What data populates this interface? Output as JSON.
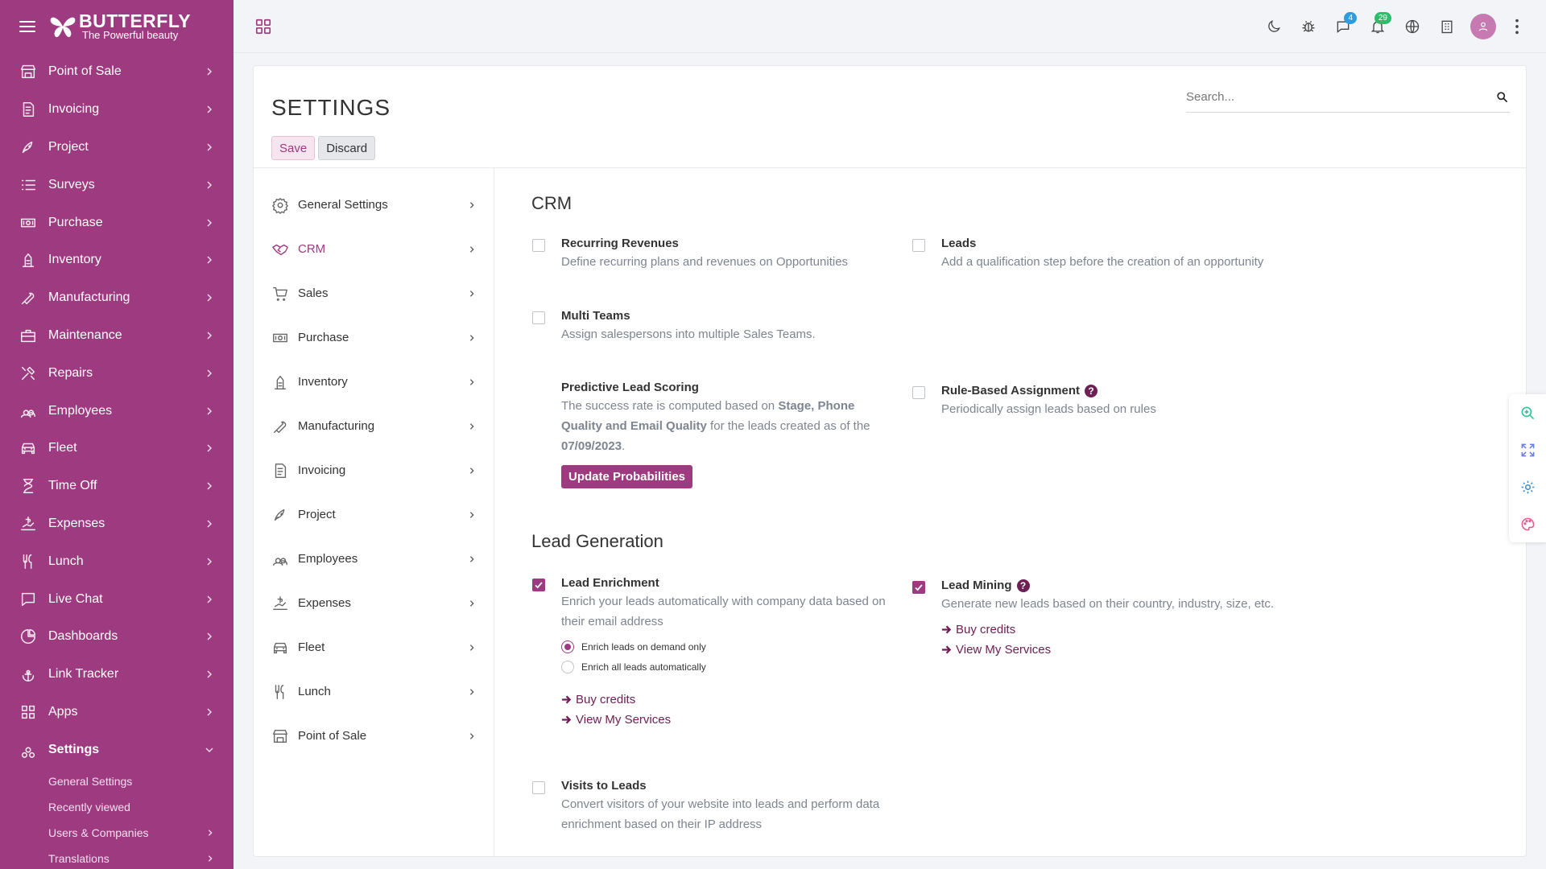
{
  "brand": {
    "name": "BUTTERFLY",
    "tagline": "The Powerful beauty"
  },
  "sidebar": {
    "items": [
      {
        "label": "Point of Sale",
        "icon": "store-icon"
      },
      {
        "label": "Invoicing",
        "icon": "invoice-icon"
      },
      {
        "label": "Project",
        "icon": "rocket-icon"
      },
      {
        "label": "Surveys",
        "icon": "list-icon"
      },
      {
        "label": "Purchase",
        "icon": "cash-icon"
      },
      {
        "label": "Inventory",
        "icon": "inventory-icon"
      },
      {
        "label": "Manufacturing",
        "icon": "wrench-icon"
      },
      {
        "label": "Maintenance",
        "icon": "briefcase-icon"
      },
      {
        "label": "Repairs",
        "icon": "tools-icon"
      },
      {
        "label": "Employees",
        "icon": "users-icon"
      },
      {
        "label": "Fleet",
        "icon": "car-icon"
      },
      {
        "label": "Time Off",
        "icon": "hourglass-icon"
      },
      {
        "label": "Expenses",
        "icon": "expense-icon"
      },
      {
        "label": "Lunch",
        "icon": "utensils-icon"
      },
      {
        "label": "Live Chat",
        "icon": "chat-icon"
      },
      {
        "label": "Dashboards",
        "icon": "pie-icon"
      },
      {
        "label": "Link Tracker",
        "icon": "anchor-icon"
      },
      {
        "label": "Apps",
        "icon": "apps-icon"
      },
      {
        "label": "Settings",
        "icon": "settings-icon"
      }
    ],
    "subitems": [
      "General Settings",
      "Recently viewed",
      "Users & Companies",
      "Translations"
    ]
  },
  "topbar": {
    "chat_badge": "4",
    "notif_badge": "29"
  },
  "page": {
    "title": "SETTINGS",
    "save_label": "Save",
    "discard_label": "Discard",
    "search_placeholder": "Search..."
  },
  "menu": [
    "General Settings",
    "CRM",
    "Sales",
    "Purchase",
    "Inventory",
    "Manufacturing",
    "Invoicing",
    "Project",
    "Employees",
    "Expenses",
    "Fleet",
    "Lunch",
    "Point of Sale"
  ],
  "crm": {
    "title": "CRM",
    "recurring": {
      "title": "Recurring Revenues",
      "desc": "Define recurring plans and revenues on Opportunities",
      "checked": false
    },
    "leads": {
      "title": "Leads",
      "desc": "Add a qualification step before the creation of an opportunity",
      "checked": false
    },
    "multi_teams": {
      "title": "Multi Teams",
      "desc": "Assign salespersons into multiple Sales Teams.",
      "checked": false
    },
    "pls": {
      "title": "Predictive Lead Scoring",
      "desc_pre": "The success rate is computed based on ",
      "desc_bold1": "Stage, Phone Quality and Email Quality",
      "desc_mid": " for the leads created as of the ",
      "desc_bold2": "07/09/2023",
      "desc_post": ".",
      "button": "Update Probabilities"
    },
    "rule_based": {
      "title": "Rule-Based Assignment",
      "desc": "Periodically assign leads based on rules",
      "checked": false
    }
  },
  "lead_gen": {
    "title": "Lead Generation",
    "enrichment": {
      "title": "Lead Enrichment",
      "desc": "Enrich your leads automatically with company data based on their email address",
      "checked": true,
      "opt1": "Enrich leads on demand only",
      "opt2": "Enrich all leads automatically",
      "selected": "opt1",
      "link1": "Buy credits",
      "link2": "View My Services"
    },
    "mining": {
      "title": "Lead Mining",
      "desc": "Generate new leads based on their country, industry, size, etc.",
      "checked": true,
      "link1": "Buy credits",
      "link2": "View My Services"
    },
    "visits": {
      "title": "Visits to Leads",
      "desc": "Convert visitors of your website into leads and perform data enrichment based on their IP address",
      "checked": false
    }
  },
  "colors": {
    "brand": "#9d3a80",
    "brand_dark": "#6d2055",
    "chat_badge": "#2f9be0",
    "notif_badge": "#2dbd6a"
  }
}
